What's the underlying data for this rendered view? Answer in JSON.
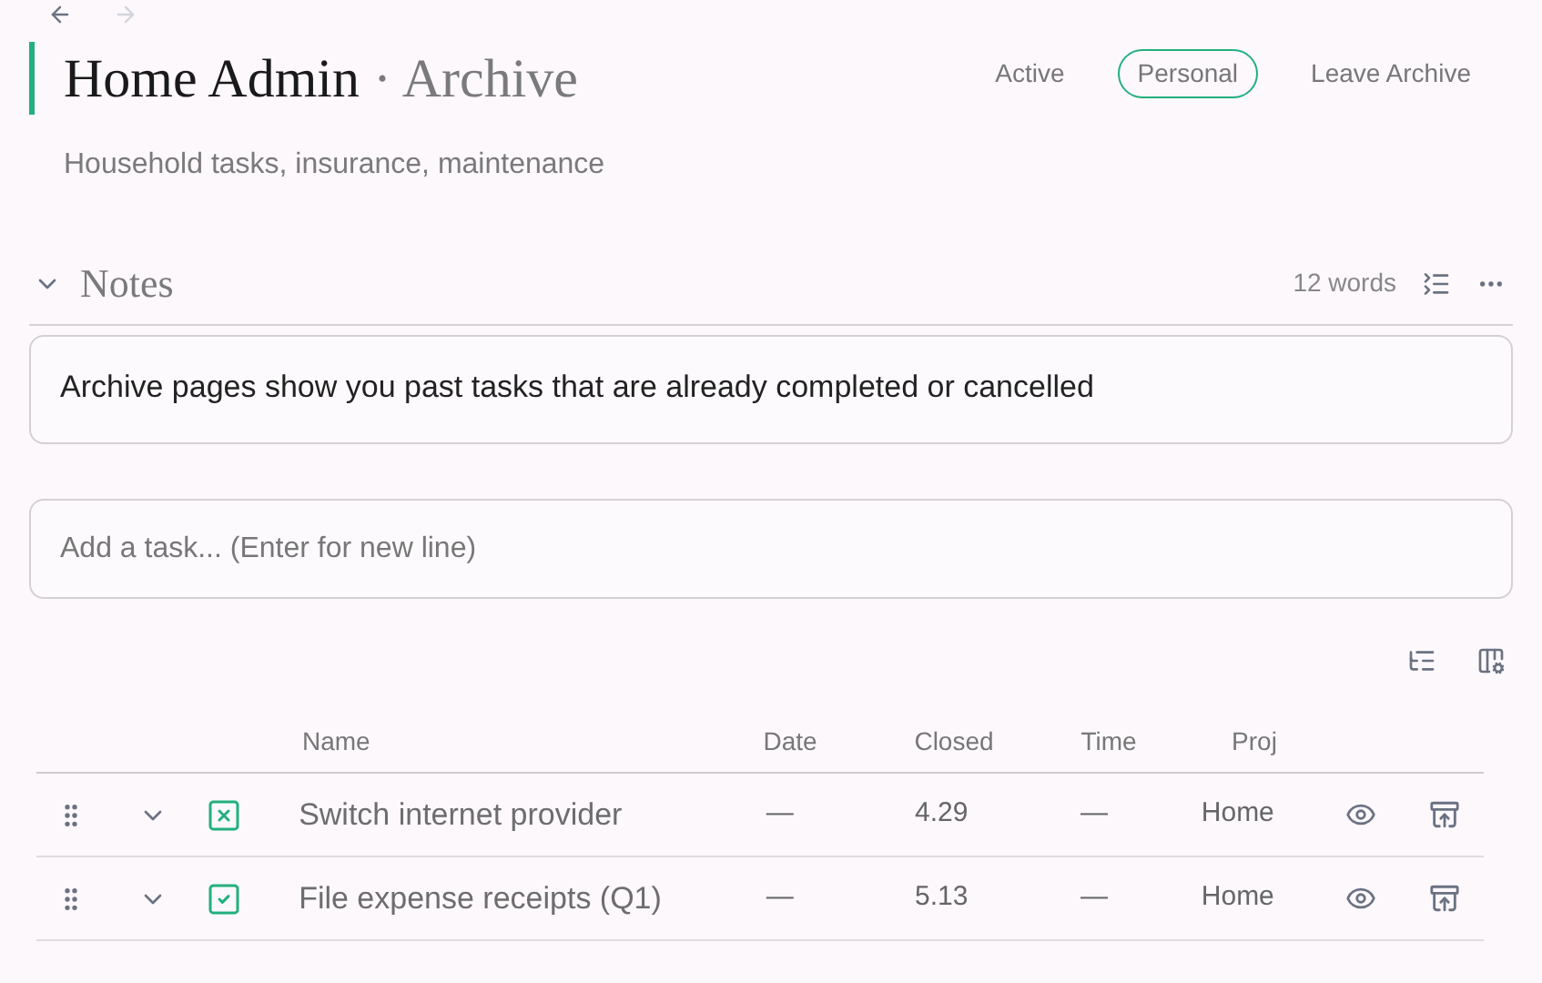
{
  "header": {
    "title": "Home Admin",
    "separator": "·",
    "subtitle": "Archive",
    "description": "Household tasks, insurance, maintenance"
  },
  "filters": [
    {
      "label": "Active",
      "selected": false
    },
    {
      "label": "Personal",
      "selected": true
    },
    {
      "label": "Leave Archive",
      "selected": false
    }
  ],
  "notes": {
    "title": "Notes",
    "expanded": true,
    "word_count": "12 words",
    "text": "Archive pages show you past tasks that are already completed or cancelled"
  },
  "task_input": {
    "placeholder": "Add a task... (Enter for new line)"
  },
  "table": {
    "columns": [
      "Name",
      "Date",
      "Closed",
      "Time",
      "Proj"
    ],
    "rows": [
      {
        "cancelled": true,
        "name": "Switch internet provider",
        "date": "—",
        "closed": "4.29",
        "time": "—",
        "proj": "Home"
      },
      {
        "cancelled": false,
        "name": "File expense receipts (Q1)",
        "date": "—",
        "closed": "5.13",
        "time": "—",
        "proj": "Home"
      }
    ]
  }
}
